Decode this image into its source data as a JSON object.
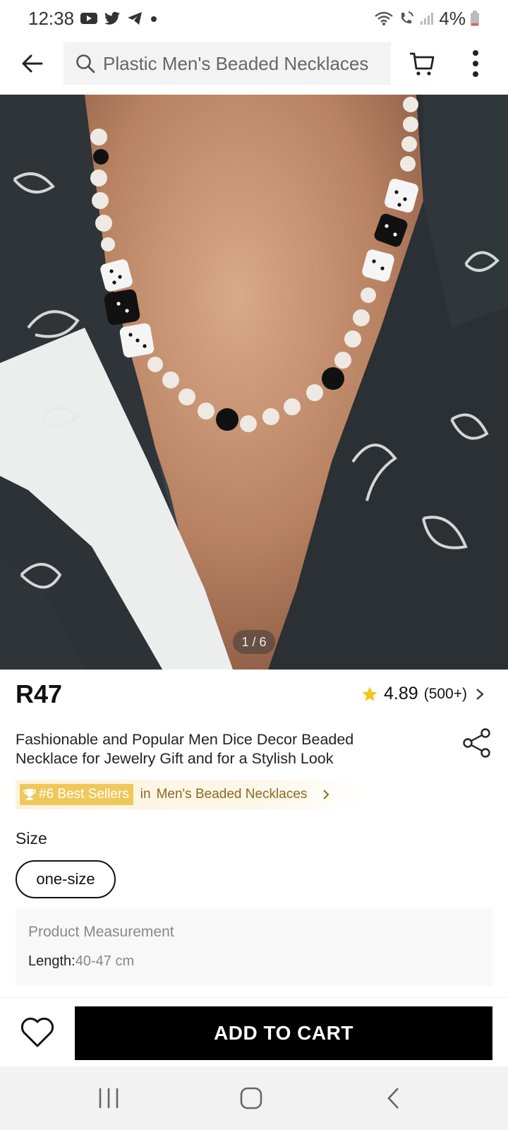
{
  "status_bar": {
    "time": "12:38",
    "battery": "4%",
    "icons": [
      "youtube-icon",
      "twitter-icon",
      "telegram-icon",
      "dot-icon",
      "wifi-icon",
      "wifi-call-icon",
      "signal-icon",
      "battery-icon"
    ]
  },
  "header": {
    "search_query": "Plastic Men's Beaded Necklaces"
  },
  "gallery": {
    "counter": "1 / 6"
  },
  "product": {
    "price": "R47",
    "rating": "4.89",
    "review_count": "(500+)",
    "title": "Fashionable and Popular Men Dice Decor Beaded Necklace for Jewelry Gift and for a Stylish Look",
    "rank_badge": "#6 Best Sellers",
    "rank_in": "in",
    "rank_category": "Men's Beaded Necklaces"
  },
  "size": {
    "label": "Size",
    "options": [
      "one-size"
    ]
  },
  "measurement": {
    "title": "Product Measurement",
    "key": "Length:",
    "value": "40-47 cm"
  },
  "actions": {
    "add_to_cart": "ADD TO CART"
  },
  "colors": {
    "accent_black": "#000000",
    "star": "#f5c518",
    "rank_badge": "#f0c85a",
    "rank_text": "#8a6a1c"
  }
}
